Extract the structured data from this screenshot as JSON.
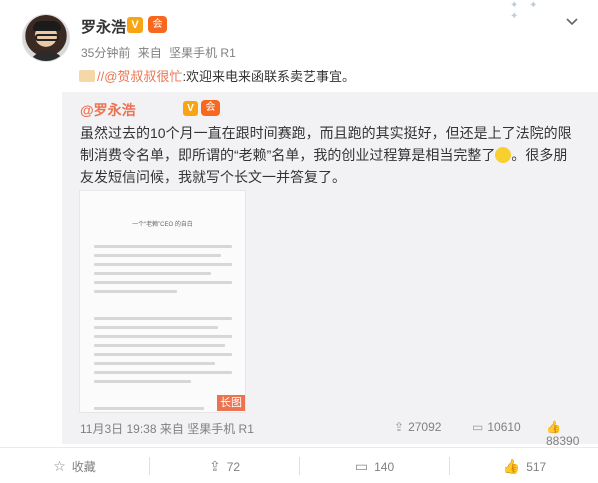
{
  "header": {
    "username": "罗永浩",
    "v_badge": "V",
    "vip_badge": "会",
    "time": "35分钟前",
    "source_prefix": "来自",
    "source": "坚果手机 R1",
    "dropdown_icon": "chevron-down-icon"
  },
  "repost": {
    "prefix": "//",
    "mention": "@贺叔叔很忙",
    "text": ":欢迎来电来函联系卖艺事宜。"
  },
  "original": {
    "author": "@罗永浩",
    "text_part1": "虽然过去的10个月一直在跟时间赛跑，而且跑的其实挺好，但还是上了法院的限制消费令名单，即所谓的“老赖”名单，我的创业过程算是相当完整了",
    "text_part2": "。很多朋友发短信问候，我就写个长文一并答复了。",
    "long_image": {
      "title": "一个“老赖”CEO 的自白",
      "badge": "长图"
    },
    "footer": {
      "time": "11月3日 19:38",
      "source_prefix": "来自",
      "source": "坚果手机 R1",
      "reposts": "27092",
      "comments": "10610",
      "likes": "88390"
    }
  },
  "actions": {
    "favorite": "收藏",
    "repost": "72",
    "comment": "140",
    "like": "517"
  }
}
